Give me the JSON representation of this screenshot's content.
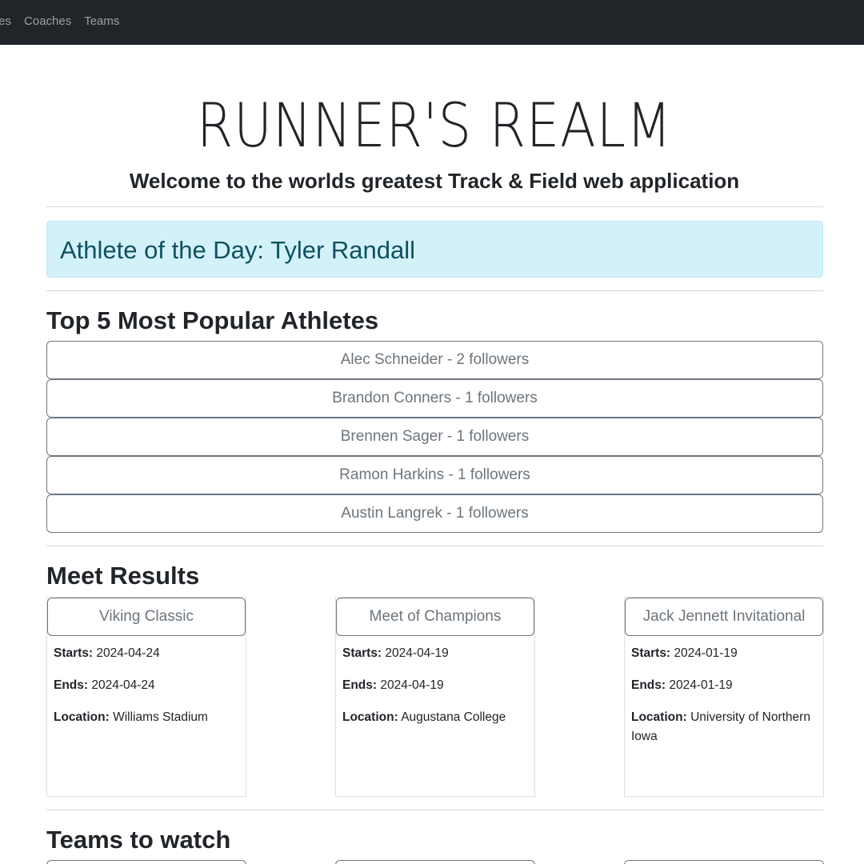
{
  "nav": {
    "links": [
      "tes",
      "Coaches",
      "Teams"
    ]
  },
  "hero": {
    "title": "RUNNER'S REALM",
    "subtitle": "Welcome to the worlds greatest Track & Field web application"
  },
  "athlete_of_day": {
    "text": "Athlete of the Day: Tyler Randall"
  },
  "popular": {
    "heading": "Top 5 Most Popular Athletes",
    "items": [
      "Alec Schneider - 2 followers",
      "Brandon Conners - 1 followers",
      "Brennen Sager - 1 followers",
      "Ramon Harkins - 1 followers",
      "Austin Langrek - 1 followers"
    ]
  },
  "meets": {
    "heading": "Meet Results",
    "labels": {
      "starts": "Starts:",
      "ends": "Ends:",
      "location": "Location:"
    },
    "items": [
      {
        "name": "Viking Classic",
        "starts": "2024-04-24",
        "ends": "2024-04-24",
        "location": "Williams Stadium"
      },
      {
        "name": "Meet of Champions",
        "starts": "2024-04-19",
        "ends": "2024-04-19",
        "location": "Augustana College"
      },
      {
        "name": "Jack Jennett Invitational",
        "starts": "2024-01-19",
        "ends": "2024-01-19",
        "location": "University of Northern Iowa"
      }
    ]
  },
  "teams": {
    "heading": "Teams to watch"
  },
  "colors": {
    "navbar": "#212529",
    "alert_bg": "#d3f1f9",
    "alert_text": "#0f5160",
    "outline_secondary": "#6c757d"
  }
}
